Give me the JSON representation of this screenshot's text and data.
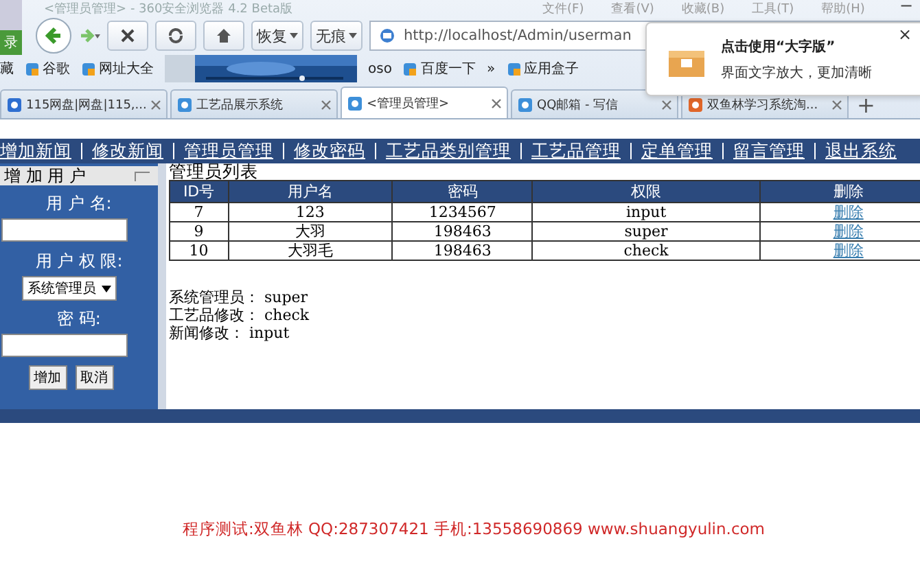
{
  "browser": {
    "title": "<管理员管理> - 360安全浏览器 4.2 Beta版",
    "menu": [
      "文件(F)",
      "查看(V)",
      "收藏(B)",
      "工具(T)",
      "帮助(H)"
    ],
    "window_button": "−",
    "login_badge": "录",
    "toolbar": {
      "buttons": [
        "恢复",
        "无痕"
      ],
      "address": "http://localhost/Admin/userman"
    },
    "bookmarks": [
      {
        "kind": "text",
        "label": "藏"
      },
      {
        "kind": "link",
        "label": "谷歌"
      },
      {
        "kind": "link",
        "label": "网址大全"
      },
      {
        "kind": "picture"
      },
      {
        "kind": "text",
        "label": "oso"
      },
      {
        "kind": "link",
        "label": "百度一下"
      },
      {
        "kind": "text",
        "label": "»"
      },
      {
        "kind": "link",
        "label": "应用盒子"
      }
    ],
    "tabs": [
      {
        "label": "115网盘|网盘|115,...",
        "selected": false
      },
      {
        "label": "工艺品展示系统",
        "selected": false
      },
      {
        "label": "<管理员管理>",
        "selected": true
      },
      {
        "label": "QQ邮箱 - 写信",
        "selected": false
      },
      {
        "label": "双鱼林学习系统淘...",
        "selected": false
      }
    ],
    "new_tab": "+",
    "notification": {
      "title": "点击使用“大字版”",
      "subtitle": "界面文字放大，更加清晰",
      "close": "×"
    }
  },
  "page": {
    "nav": [
      "增加新闻",
      "修改新闻",
      "管理员管理",
      "修改密码",
      "工艺品类别管理",
      "工艺品管理",
      "定单管理",
      "留言管理",
      "退出系统"
    ],
    "sidebar": {
      "title": "增 加 用 户",
      "username_label": "用 户 名:",
      "role_label": "用 户 权 限:",
      "role_value": "系统管理员",
      "password_label": "密 码:",
      "buttons": [
        "增加",
        "取消"
      ]
    },
    "list": {
      "title": "管理员列表",
      "columns": [
        "ID号",
        "用户名",
        "密码",
        "权限",
        "删除"
      ],
      "rows": [
        [
          "7",
          "123",
          "1234567",
          "input",
          "删除"
        ],
        [
          "9",
          "大羽",
          "198463",
          "super",
          "删除"
        ],
        [
          "10",
          "大羽毛",
          "198463",
          "check",
          "删除"
        ]
      ]
    },
    "legend": [
      "系统管理员： super",
      "工艺品修改： check",
      "新闻修改： input"
    ],
    "footer": "程序测试:双鱼林 QQ:287307421 手机:13558690869 www.shuangyulin.com"
  }
}
